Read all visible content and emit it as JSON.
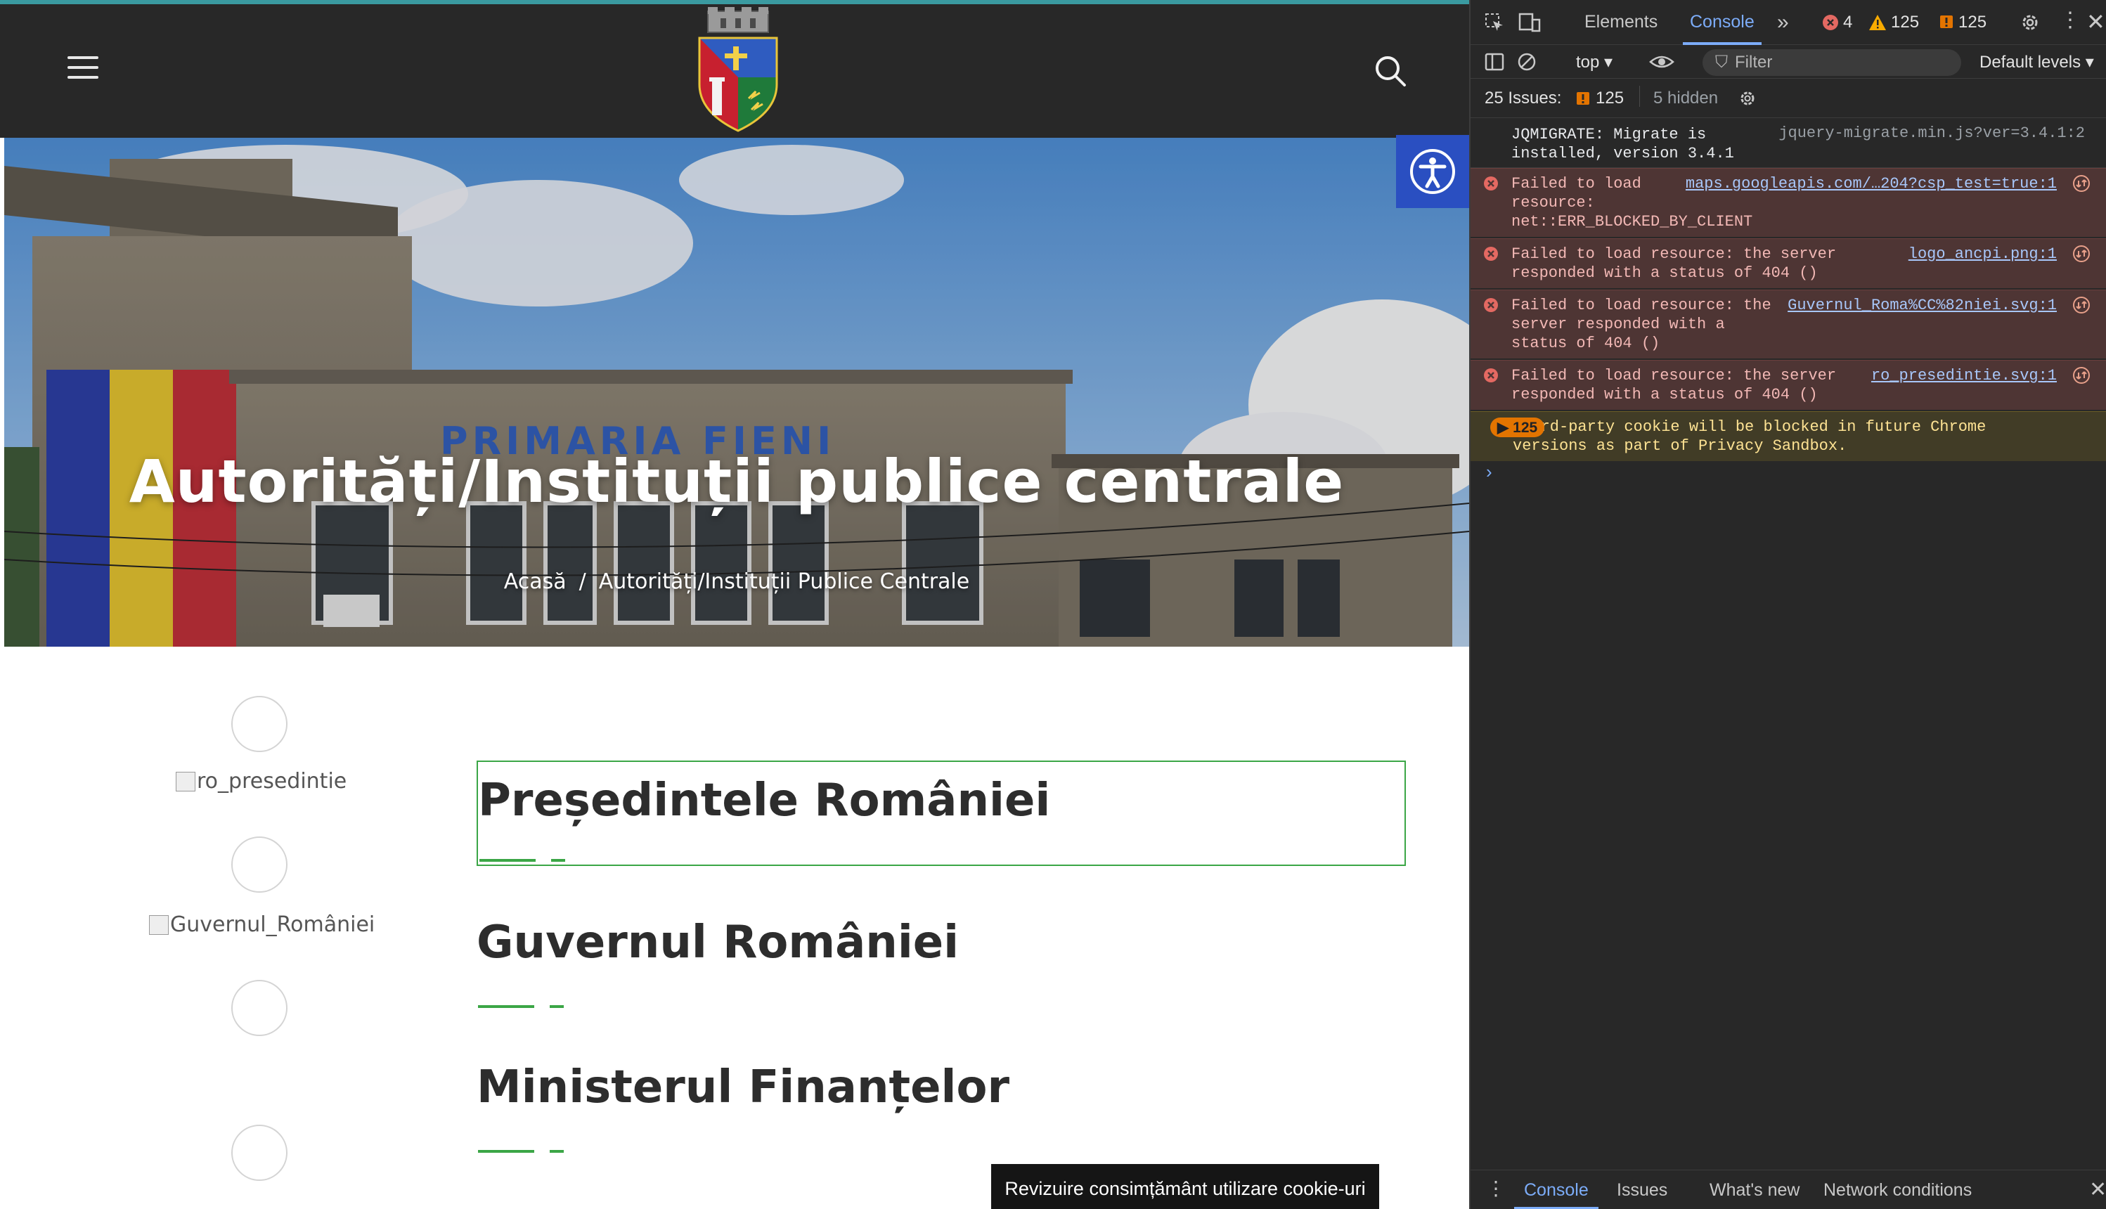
{
  "site": {
    "hero_title": "Autorități/Instituții publice centrale",
    "breadcrumb": {
      "home": "Acasă",
      "separator": "/",
      "current": "Autorități/Instituții Publice Centrale"
    },
    "building_sign": "PRIMARIA FIENI",
    "entries": [
      {
        "img_alt": "ro_presedintie",
        "title": "Președintele României"
      },
      {
        "img_alt": "Guvernul_României",
        "title": "Guvernul României"
      },
      {
        "img_alt": "",
        "title": "Ministerul Finanțelor"
      }
    ],
    "cookie_bar": "Revizuire consimțământ utilizare cookie-uri",
    "colors": {
      "header_bg": "#282828",
      "accent_green": "#3ba646",
      "a11y_blue": "#2a4fc1"
    }
  },
  "devtools": {
    "tabs": {
      "elements": "Elements",
      "console": "Console"
    },
    "counts": {
      "errors": "4",
      "warnings": "125",
      "issues": "125"
    },
    "toolbar": {
      "context": "top",
      "filter_placeholder": "Filter",
      "levels": "Default levels"
    },
    "issues_bar": {
      "label": "25 Issues:",
      "count": "125",
      "hidden": "5 hidden"
    },
    "messages": [
      {
        "type": "info",
        "text": "JQMIGRATE: Migrate is installed, version 3.4.1",
        "source": "jquery-migrate.min.js?ver=3.4.1:2"
      },
      {
        "type": "error",
        "text": "Failed to load resource: net::ERR_BLOCKED_BY_CLIENT",
        "source": "maps.googleapis.com/…204?csp_test=true:1"
      },
      {
        "type": "error",
        "text": "Failed to load resource: the server responded with a status of 404 ()",
        "source": "logo_ancpi.png:1"
      },
      {
        "type": "error",
        "text": "Failed to load resource: the server responded with a status of 404 ()",
        "source": "Guvernul_Roma%CC%82niei.svg:1"
      },
      {
        "type": "error",
        "text": "Failed to load resource: the server responded with a status of 404 ()",
        "source": "ro_presedintie.svg:1"
      },
      {
        "type": "warning",
        "count": "125",
        "text": "Third-party cookie will be blocked in future Chrome versions as part of Privacy Sandbox."
      }
    ],
    "bottom_tabs": [
      "Console",
      "Issues",
      "What's new",
      "Network conditions"
    ]
  }
}
